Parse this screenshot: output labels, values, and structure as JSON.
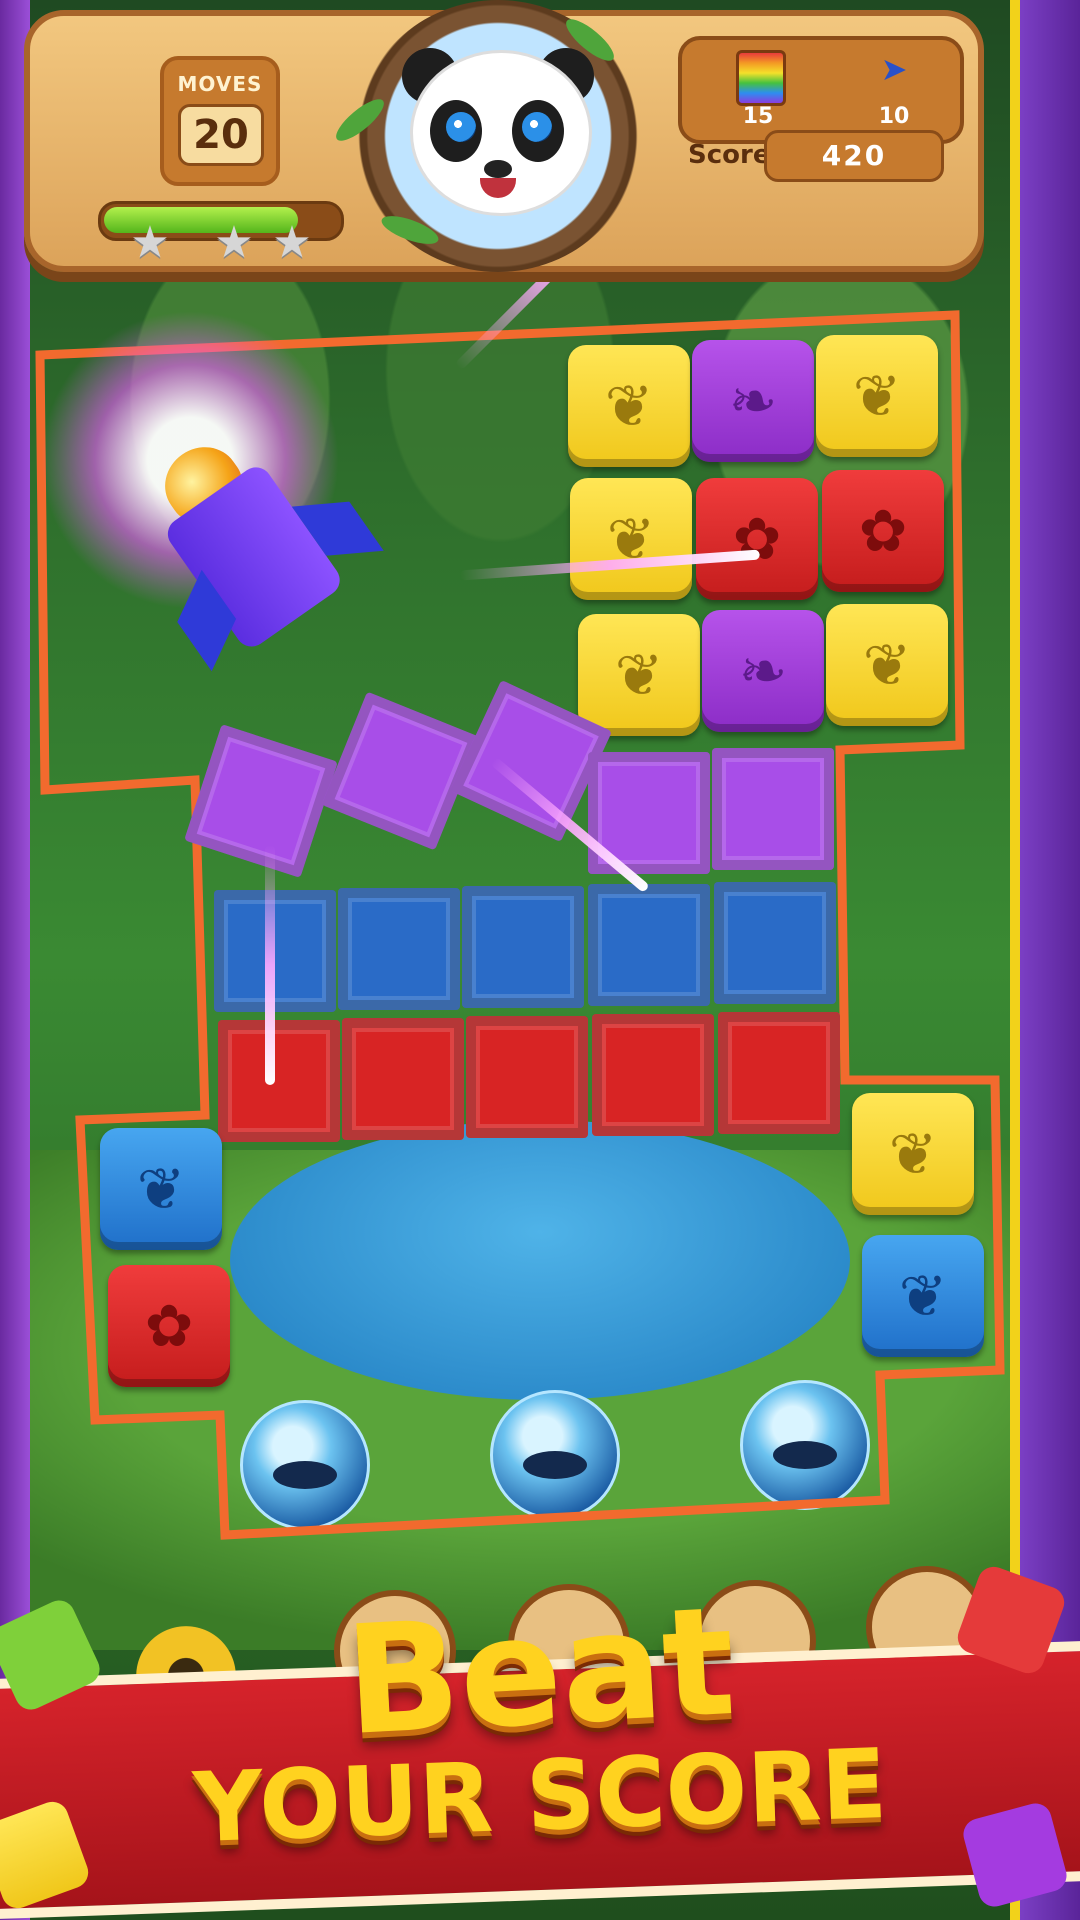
{
  "hud": {
    "moves_label": "MOVES",
    "moves_value": "20",
    "progress_fraction": 0.85,
    "stars_earned": 0,
    "stars_total": 3,
    "goals": [
      {
        "icon": "rainbow-crate-icon",
        "count": "15"
      },
      {
        "icon": "fish-icon",
        "count": "10"
      }
    ],
    "score_label": "Score",
    "score_value": "420",
    "character": "panda-avatar"
  },
  "board": {
    "tile_colors": {
      "yellow": "#f0c71a",
      "purple": "#8b2cc6",
      "red": "#c41c1c",
      "blue": "#1f6fc9"
    },
    "tiles": [
      {
        "color": "yellow",
        "icon": "bamboo-icon"
      },
      {
        "color": "purple",
        "icon": "leaf-icon"
      },
      {
        "color": "yellow",
        "icon": "bamboo-icon"
      },
      {
        "color": "yellow",
        "icon": "bamboo-icon"
      },
      {
        "color": "red",
        "icon": "paw-icon"
      },
      {
        "color": "red",
        "icon": "paw-icon"
      },
      {
        "color": "yellow",
        "icon": "bamboo-icon"
      },
      {
        "color": "purple",
        "icon": "leaf-icon"
      },
      {
        "color": "yellow",
        "icon": "bamboo-icon"
      },
      {
        "color": "blue",
        "icon": "bamboo-icon"
      },
      {
        "color": "red",
        "icon": "paw-icon"
      },
      {
        "color": "yellow",
        "icon": "bamboo-icon"
      },
      {
        "color": "blue",
        "icon": "bamboo-icon"
      }
    ],
    "crate_rows": [
      "purple",
      "blue",
      "red"
    ],
    "fish_bowls": 3,
    "booster": "rocket-booster"
  },
  "toolbar": {
    "boosters": [
      "settings-gear-icon",
      "booster-1",
      "booster-2",
      "booster-leaf",
      "booster-hammer"
    ]
  },
  "banner": {
    "line1": "Beat",
    "line2": "YOUR SCORE"
  }
}
